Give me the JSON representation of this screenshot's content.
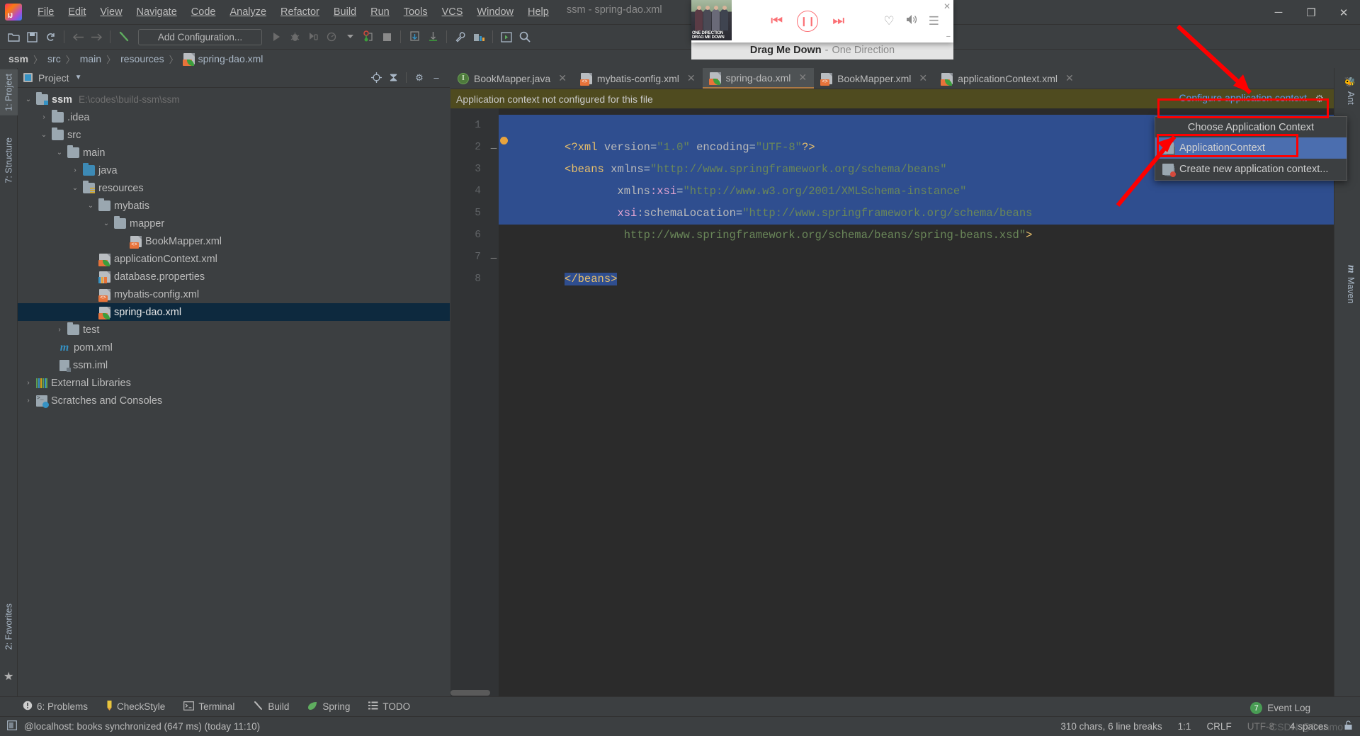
{
  "window": {
    "title": "ssm - spring-dao.xml",
    "minimize": "─",
    "maximize": "❐",
    "close": "✕"
  },
  "menubar": {
    "items": [
      {
        "label": "File"
      },
      {
        "label": "Edit"
      },
      {
        "label": "View"
      },
      {
        "label": "Navigate"
      },
      {
        "label": "Code"
      },
      {
        "label": "Analyze"
      },
      {
        "label": "Refactor"
      },
      {
        "label": "Build"
      },
      {
        "label": "Run"
      },
      {
        "label": "Tools"
      },
      {
        "label": "VCS"
      },
      {
        "label": "Window"
      },
      {
        "label": "Help"
      }
    ]
  },
  "toolbar": {
    "add_configuration": "Add Configuration...",
    "icons": [
      "open-folder-icon",
      "save-icon",
      "sync-icon",
      "back-arrow-icon",
      "forward-arrow-icon",
      "build-hammer-icon",
      "run-icon",
      "debug-icon",
      "coverage-icon",
      "profile-icon",
      "attach-debugger-icon",
      "stop-icon",
      "update-project-icon",
      "commit-icon",
      "settings-wrench-icon",
      "project-structure-icon",
      "run-anything-icon",
      "search-everywhere-icon"
    ]
  },
  "breadcrumb": {
    "items": [
      "ssm",
      "src",
      "main",
      "resources",
      "spring-dao.xml"
    ],
    "separator": "〉"
  },
  "left_stripe": {
    "tabs": [
      {
        "label": "1: Project",
        "selected": true
      },
      {
        "label": "7: Structure",
        "selected": false
      },
      {
        "label": "2: Favorites",
        "selected": false
      }
    ]
  },
  "right_stripe": {
    "tabs": [
      {
        "label": "Ant",
        "icon": "ant-bug-icon"
      },
      {
        "label": "Maven",
        "icon": "maven-m-icon"
      }
    ]
  },
  "project_panel": {
    "title": "Project",
    "tools": [
      "locate-icon",
      "collapse-all-icon",
      "settings-gear-icon",
      "hide-icon"
    ],
    "tree": [
      {
        "label": "ssm",
        "path": "E:\\codes\\build-ssm\\ssm",
        "indent": 0,
        "arrow": "⌄",
        "icon": "module-folder-icon",
        "bold": true,
        "selected": false
      },
      {
        "label": ".idea",
        "path": "",
        "indent": 1,
        "arrow": "›",
        "icon": "folder-icon",
        "bold": false,
        "selected": false
      },
      {
        "label": "src",
        "path": "",
        "indent": 1,
        "arrow": "⌄",
        "icon": "folder-icon",
        "bold": false,
        "selected": false
      },
      {
        "label": "main",
        "path": "",
        "indent": 2,
        "arrow": "⌄",
        "icon": "folder-icon",
        "bold": false,
        "selected": false
      },
      {
        "label": "java",
        "path": "",
        "indent": 3,
        "arrow": "›",
        "icon": "source-folder-icon",
        "bold": false,
        "selected": false
      },
      {
        "label": "resources",
        "path": "",
        "indent": 3,
        "arrow": "⌄",
        "icon": "resource-folder-icon",
        "bold": false,
        "selected": false
      },
      {
        "label": "mybatis",
        "path": "",
        "indent": 4,
        "arrow": "⌄",
        "icon": "folder-icon",
        "bold": false,
        "selected": false
      },
      {
        "label": "mapper",
        "path": "",
        "indent": 5,
        "arrow": "⌄",
        "icon": "folder-icon",
        "bold": false,
        "selected": false
      },
      {
        "label": "BookMapper.xml",
        "path": "",
        "indent": 6,
        "arrow": "",
        "icon": "xml-file-icon",
        "bold": false,
        "selected": false
      },
      {
        "label": "applicationContext.xml",
        "path": "",
        "indent": 4,
        "arrow": "",
        "icon": "spring-xml-file-icon",
        "bold": false,
        "selected": false
      },
      {
        "label": "database.properties",
        "path": "",
        "indent": 4,
        "arrow": "",
        "icon": "properties-file-icon",
        "bold": false,
        "selected": false
      },
      {
        "label": "mybatis-config.xml",
        "path": "",
        "indent": 4,
        "arrow": "",
        "icon": "xml-file-icon",
        "bold": false,
        "selected": false
      },
      {
        "label": "spring-dao.xml",
        "path": "",
        "indent": 4,
        "arrow": "",
        "icon": "spring-xml-file-icon",
        "bold": false,
        "selected": true
      },
      {
        "label": "test",
        "path": "",
        "indent": 2,
        "arrow": "›",
        "icon": "folder-icon",
        "bold": false,
        "selected": false
      },
      {
        "label": "pom.xml",
        "path": "",
        "indent": 1,
        "arrow": "",
        "icon": "maven-pom-icon",
        "bold": false,
        "selected": false
      },
      {
        "label": "ssm.iml",
        "path": "",
        "indent": 1,
        "arrow": "",
        "icon": "iml-file-icon",
        "bold": false,
        "selected": false
      },
      {
        "label": "External Libraries",
        "path": "",
        "indent": 0,
        "arrow": "›",
        "icon": "libraries-icon",
        "bold": false,
        "selected": false
      },
      {
        "label": "Scratches and Consoles",
        "path": "",
        "indent": 0,
        "arrow": "›",
        "icon": "scratches-icon",
        "bold": false,
        "selected": false
      }
    ]
  },
  "editor": {
    "tabs": [
      {
        "label": "BookMapper.java",
        "icon": "java-file-icon",
        "active": false
      },
      {
        "label": "mybatis-config.xml",
        "icon": "xml-file-icon",
        "active": false
      },
      {
        "label": "spring-dao.xml",
        "icon": "spring-xml-file-icon",
        "active": true
      },
      {
        "label": "BookMapper.xml",
        "icon": "xml-file-icon",
        "active": false
      },
      {
        "label": "applicationContext.xml",
        "icon": "spring-xml-file-icon",
        "active": false
      }
    ],
    "close_glyph": "✕",
    "notification": {
      "text": "Application context not configured for this file",
      "link": "Configure application context",
      "gear": "⚙"
    },
    "line_numbers": [
      "1",
      "2",
      "3",
      "4",
      "5",
      "6",
      "7",
      "8"
    ],
    "code_lines": [
      [
        {
          "t": "<?xml ",
          "c": "tag"
        },
        {
          "t": "version",
          "c": "attr"
        },
        {
          "t": "=",
          "c": "plain"
        },
        {
          "t": "\"1.0\"",
          "c": "str"
        },
        {
          "t": " ",
          "c": "plain"
        },
        {
          "t": "encoding",
          "c": "attr"
        },
        {
          "t": "=",
          "c": "plain"
        },
        {
          "t": "\"UTF-8\"",
          "c": "str"
        },
        {
          "t": "?>",
          "c": "tag"
        }
      ],
      [
        {
          "t": "<beans ",
          "c": "tag"
        },
        {
          "t": "xmlns",
          "c": "attr"
        },
        {
          "t": "=",
          "c": "plain"
        },
        {
          "t": "\"http://www.springframework.org/schema/beans\"",
          "c": "str"
        }
      ],
      [
        {
          "t": "        xmlns",
          "c": "attr"
        },
        {
          "t": ":xsi",
          "c": "ns"
        },
        {
          "t": "=",
          "c": "plain"
        },
        {
          "t": "\"http://www.w3.org/2001/XMLSchema-instance\"",
          "c": "str"
        }
      ],
      [
        {
          "t": "        ",
          "c": "plain"
        },
        {
          "t": "xsi",
          "c": "ns"
        },
        {
          "t": ":schemaLocation",
          "c": "attr"
        },
        {
          "t": "=",
          "c": "plain"
        },
        {
          "t": "\"http://www.springframework.org/schema/beans",
          "c": "str"
        }
      ],
      [
        {
          "t": "         http://www.springframework.org/schema/beans/spring-beans.xsd\"",
          "c": "str"
        },
        {
          "t": ">",
          "c": "tag"
        }
      ],
      [],
      [
        {
          "t": "</beans>",
          "c": "tag"
        }
      ],
      []
    ],
    "fold_marks": [
      "",
      "─",
      "",
      "",
      "",
      "",
      "─",
      ""
    ]
  },
  "dropdown": {
    "header": "Choose Application Context",
    "items": [
      {
        "label": "ApplicationContext",
        "icon": "application-context-icon",
        "selected": true
      },
      {
        "label": "Create new application context...",
        "icon": "create-context-icon",
        "selected": false
      }
    ]
  },
  "music_player": {
    "song": "Drag Me Down",
    "separator": "-",
    "artist": "One Direction",
    "album_text": "ONE DIRECTION\nDRAG ME DOWN",
    "controls": {
      "previous": "⏮",
      "pause": "❙❙",
      "next": "⏭",
      "favorite": "♡",
      "volume": "🔊",
      "playlist": "☰",
      "close": "✕",
      "minimize": "−"
    }
  },
  "tool_windows": {
    "items": [
      {
        "label": "6: Problems",
        "icon": "problems-icon",
        "mnemonic": "6"
      },
      {
        "label": "CheckStyle",
        "icon": "checkstyle-icon",
        "mnemonic": ""
      },
      {
        "label": "Terminal",
        "icon": "terminal-icon",
        "mnemonic": ""
      },
      {
        "label": "Build",
        "icon": "build-icon",
        "mnemonic": ""
      },
      {
        "label": "Spring",
        "icon": "spring-icon",
        "mnemonic": ""
      },
      {
        "label": "TODO",
        "icon": "todo-icon",
        "mnemonic": ""
      }
    ],
    "event_log": {
      "label": "Event Log",
      "count": "7"
    }
  },
  "statusbar": {
    "message": "@localhost: books synchronized (647 ms) (today 11:10)",
    "chars": "310 chars, 6 line breaks",
    "caret": "1:1",
    "line_ending": "CRLF",
    "encoding": "UTF-8",
    "indent": "4 spaces",
    "lock": "🔓",
    "watermark": "CSDN @Danmo"
  },
  "colors": {
    "accent_blue": "#589df6",
    "selection_blue": "#2f4e8f",
    "menu_select_blue": "#4b6eaf",
    "notification_olive": "#4f4b1f",
    "annotation_red": "#fe0000",
    "player_pink": "#fb6f74",
    "tree_selection": "#0d293e"
  }
}
